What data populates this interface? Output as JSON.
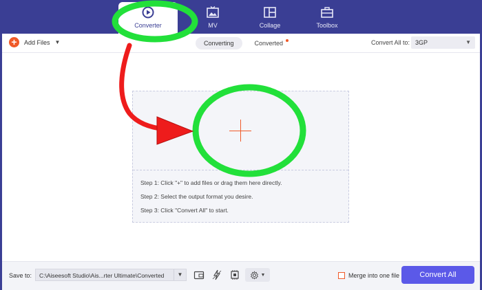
{
  "nav": {
    "tabs": [
      {
        "label": "Converter",
        "icon": "play-circle-icon",
        "active": true
      },
      {
        "label": "MV",
        "icon": "tv-image-icon",
        "active": false
      },
      {
        "label": "Collage",
        "icon": "collage-grid-icon",
        "active": false
      },
      {
        "label": "Toolbox",
        "icon": "toolbox-icon",
        "active": false
      }
    ]
  },
  "toolbar": {
    "add_files": "Add Files",
    "tabs": [
      "Converting",
      "Converted"
    ],
    "convert_all_to_label": "Convert All to:",
    "format": "3GP"
  },
  "dropzone": {
    "steps": [
      "Step 1: Click \"+\" to add files or drag them here directly.",
      "Step 2: Select the output format you desire.",
      "Step 3: Click \"Convert All\" to start."
    ]
  },
  "bottom": {
    "save_to_label": "Save to:",
    "path": "C:\\Aiseesoft Studio\\Ais...rter Ultimate\\Converted",
    "merge_label": "Merge into one file",
    "convert_all": "Convert All"
  },
  "colors": {
    "nav_bg": "#3a3e94",
    "accent_orange": "#f05a28",
    "convert_button": "#5b59e8",
    "annotation_green": "#22e03a",
    "annotation_red": "#ee1c1c"
  }
}
